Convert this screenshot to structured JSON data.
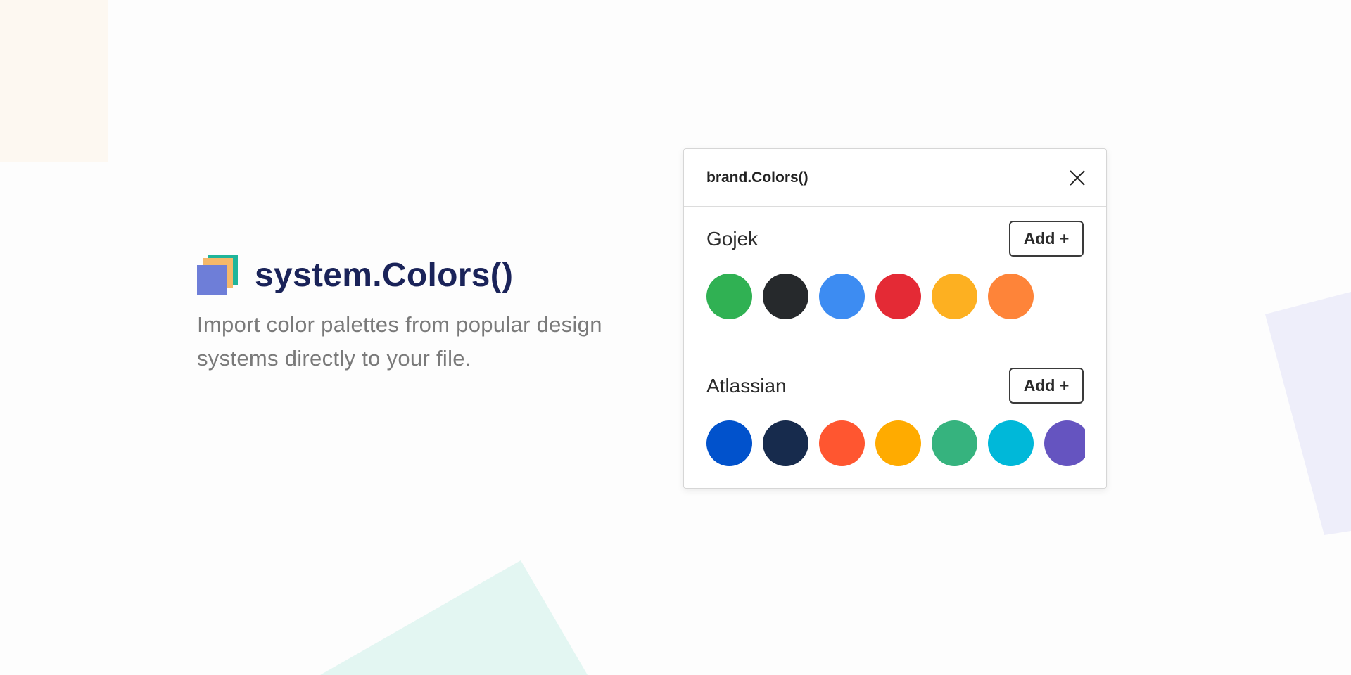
{
  "hero": {
    "title": "system.Colors()",
    "subtitle": "Import color palettes from popular design systems directly to your file."
  },
  "panel": {
    "title": "brand.Colors()",
    "close_icon": "close-icon",
    "palettes": [
      {
        "name": "Gojek",
        "add_label": "Add +",
        "colors": [
          "#30b153",
          "#26292c",
          "#3d8cf2",
          "#e42a35",
          "#fdb021",
          "#fe8439"
        ]
      },
      {
        "name": "Atlassian",
        "add_label": "Add +",
        "colors": [
          "#0152cc",
          "#172b4d",
          "#ff5630",
          "#ffab00",
          "#36b37e",
          "#00b8d9",
          "#6554c0"
        ]
      }
    ]
  },
  "colors": {
    "brand_navy": "#1a2359",
    "logo_teal": "#1fb59a",
    "logo_orange": "#f5b86a",
    "logo_purple": "#6e7ed8"
  }
}
